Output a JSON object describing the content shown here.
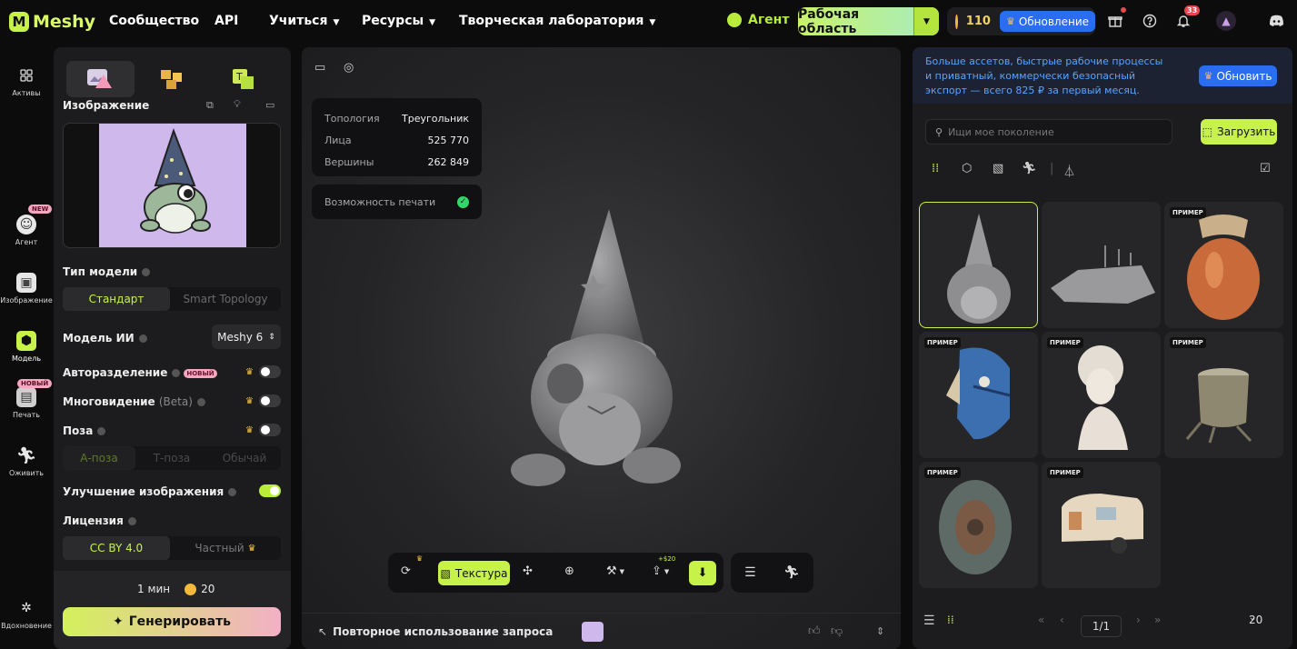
{
  "topbar": {
    "logo": "Meshy",
    "nav": [
      {
        "label": "Сообщество",
        "dropdown": false
      },
      {
        "label": "API",
        "dropdown": false
      },
      {
        "label": "Учиться",
        "dropdown": true
      },
      {
        "label": "Ресурсы",
        "dropdown": true
      },
      {
        "label": "Творческая лаборатория",
        "dropdown": true
      }
    ],
    "agent": "Агент",
    "workspace": "Рабочая область",
    "credits": "110",
    "upgrade": "Обновление",
    "notifications_count": "33"
  },
  "rail": [
    {
      "label": "Активы",
      "icon": "grid-icon"
    },
    {
      "label": "Агент",
      "icon": "agent-icon",
      "tag": "NEW"
    },
    {
      "label": "Изображение",
      "icon": "image-icon"
    },
    {
      "label": "Модель",
      "icon": "cube-icon",
      "active": true
    },
    {
      "label": "Печать",
      "icon": "printer-icon",
      "tag": "НОВЫЙ"
    },
    {
      "label": "Оживить",
      "icon": "running-icon"
    },
    {
      "label": "Вдохновение",
      "icon": "sparkle-icon"
    }
  ],
  "panel": {
    "image_title": "Изображение",
    "model_type_label": "Тип модели",
    "model_type_options": [
      "Стандарт",
      "Smart Topology"
    ],
    "ai_model_label": "Модель ИИ",
    "ai_model_value": "Meshy 6",
    "auto_split_label": "Авторазделение",
    "auto_split_tag": "НОВЫЙ",
    "multiview_label": "Многовидение",
    "multiview_suffix": "(Beta)",
    "pose_label": "Поза",
    "pose_options": [
      "А-поза",
      "Т-поза",
      "Обычай"
    ],
    "enhance_label": "Улучшение изображения",
    "license_label": "Лицензия",
    "license_options": [
      "CC BY 4.0",
      "Частный"
    ],
    "time": "1 мин",
    "cost": "20",
    "generate": "Генерировать"
  },
  "viewer": {
    "stats": [
      {
        "k": "Топология",
        "v": "Треугольник"
      },
      {
        "k": "Лица",
        "v": "525 770"
      },
      {
        "k": "Вершины",
        "v": "262 849"
      }
    ],
    "printability": "Возможность печати",
    "texture_btn": "Текстура",
    "price_tag": "+$20",
    "reuse_prompt": "Повторное использование запроса"
  },
  "right": {
    "promo_text": "Больше ассетов, быстрые рабочие процессы и приватный, коммерчески безопасный экспорт — всего 825 ₽ за первый месяц.",
    "promo_btn": "Обновить",
    "search_placeholder": "Ищи мое поколение",
    "upload": "Загрузить",
    "example_tag": "ПРИМЕР",
    "page": "1/1",
    "per_page": "20"
  },
  "colors": {
    "accent": "#c6f24a",
    "blue": "#2a6df0",
    "panel": "#1c1c1e"
  }
}
